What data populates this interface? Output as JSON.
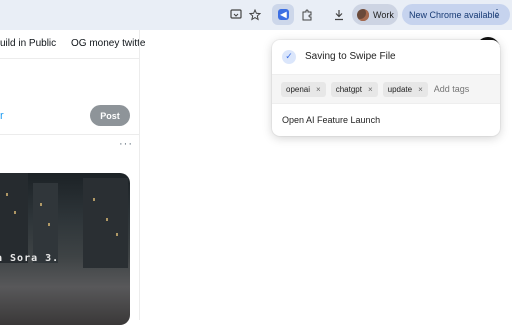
{
  "browser": {
    "profile_label": "Work",
    "update_label": "New Chrome available",
    "icons": [
      "tab-search-icon",
      "star-icon",
      "extension-logo-icon",
      "puzzle-icon",
      "download-icon",
      "avatar",
      "kebab-icon"
    ]
  },
  "page": {
    "tabs": [
      "uild in Public",
      "OG money twitte"
    ],
    "compose_char": "r",
    "post_label": "Post",
    "more_label": "···",
    "media_caption": "a Sora 3."
  },
  "popup": {
    "title": "Saving to Swipe File",
    "tags": [
      {
        "label": "openai"
      },
      {
        "label": "chatgpt"
      },
      {
        "label": "update"
      }
    ],
    "tag_placeholder": "Add tags",
    "item": "Open AI Feature Launch",
    "accent": "#3d6fe3"
  }
}
